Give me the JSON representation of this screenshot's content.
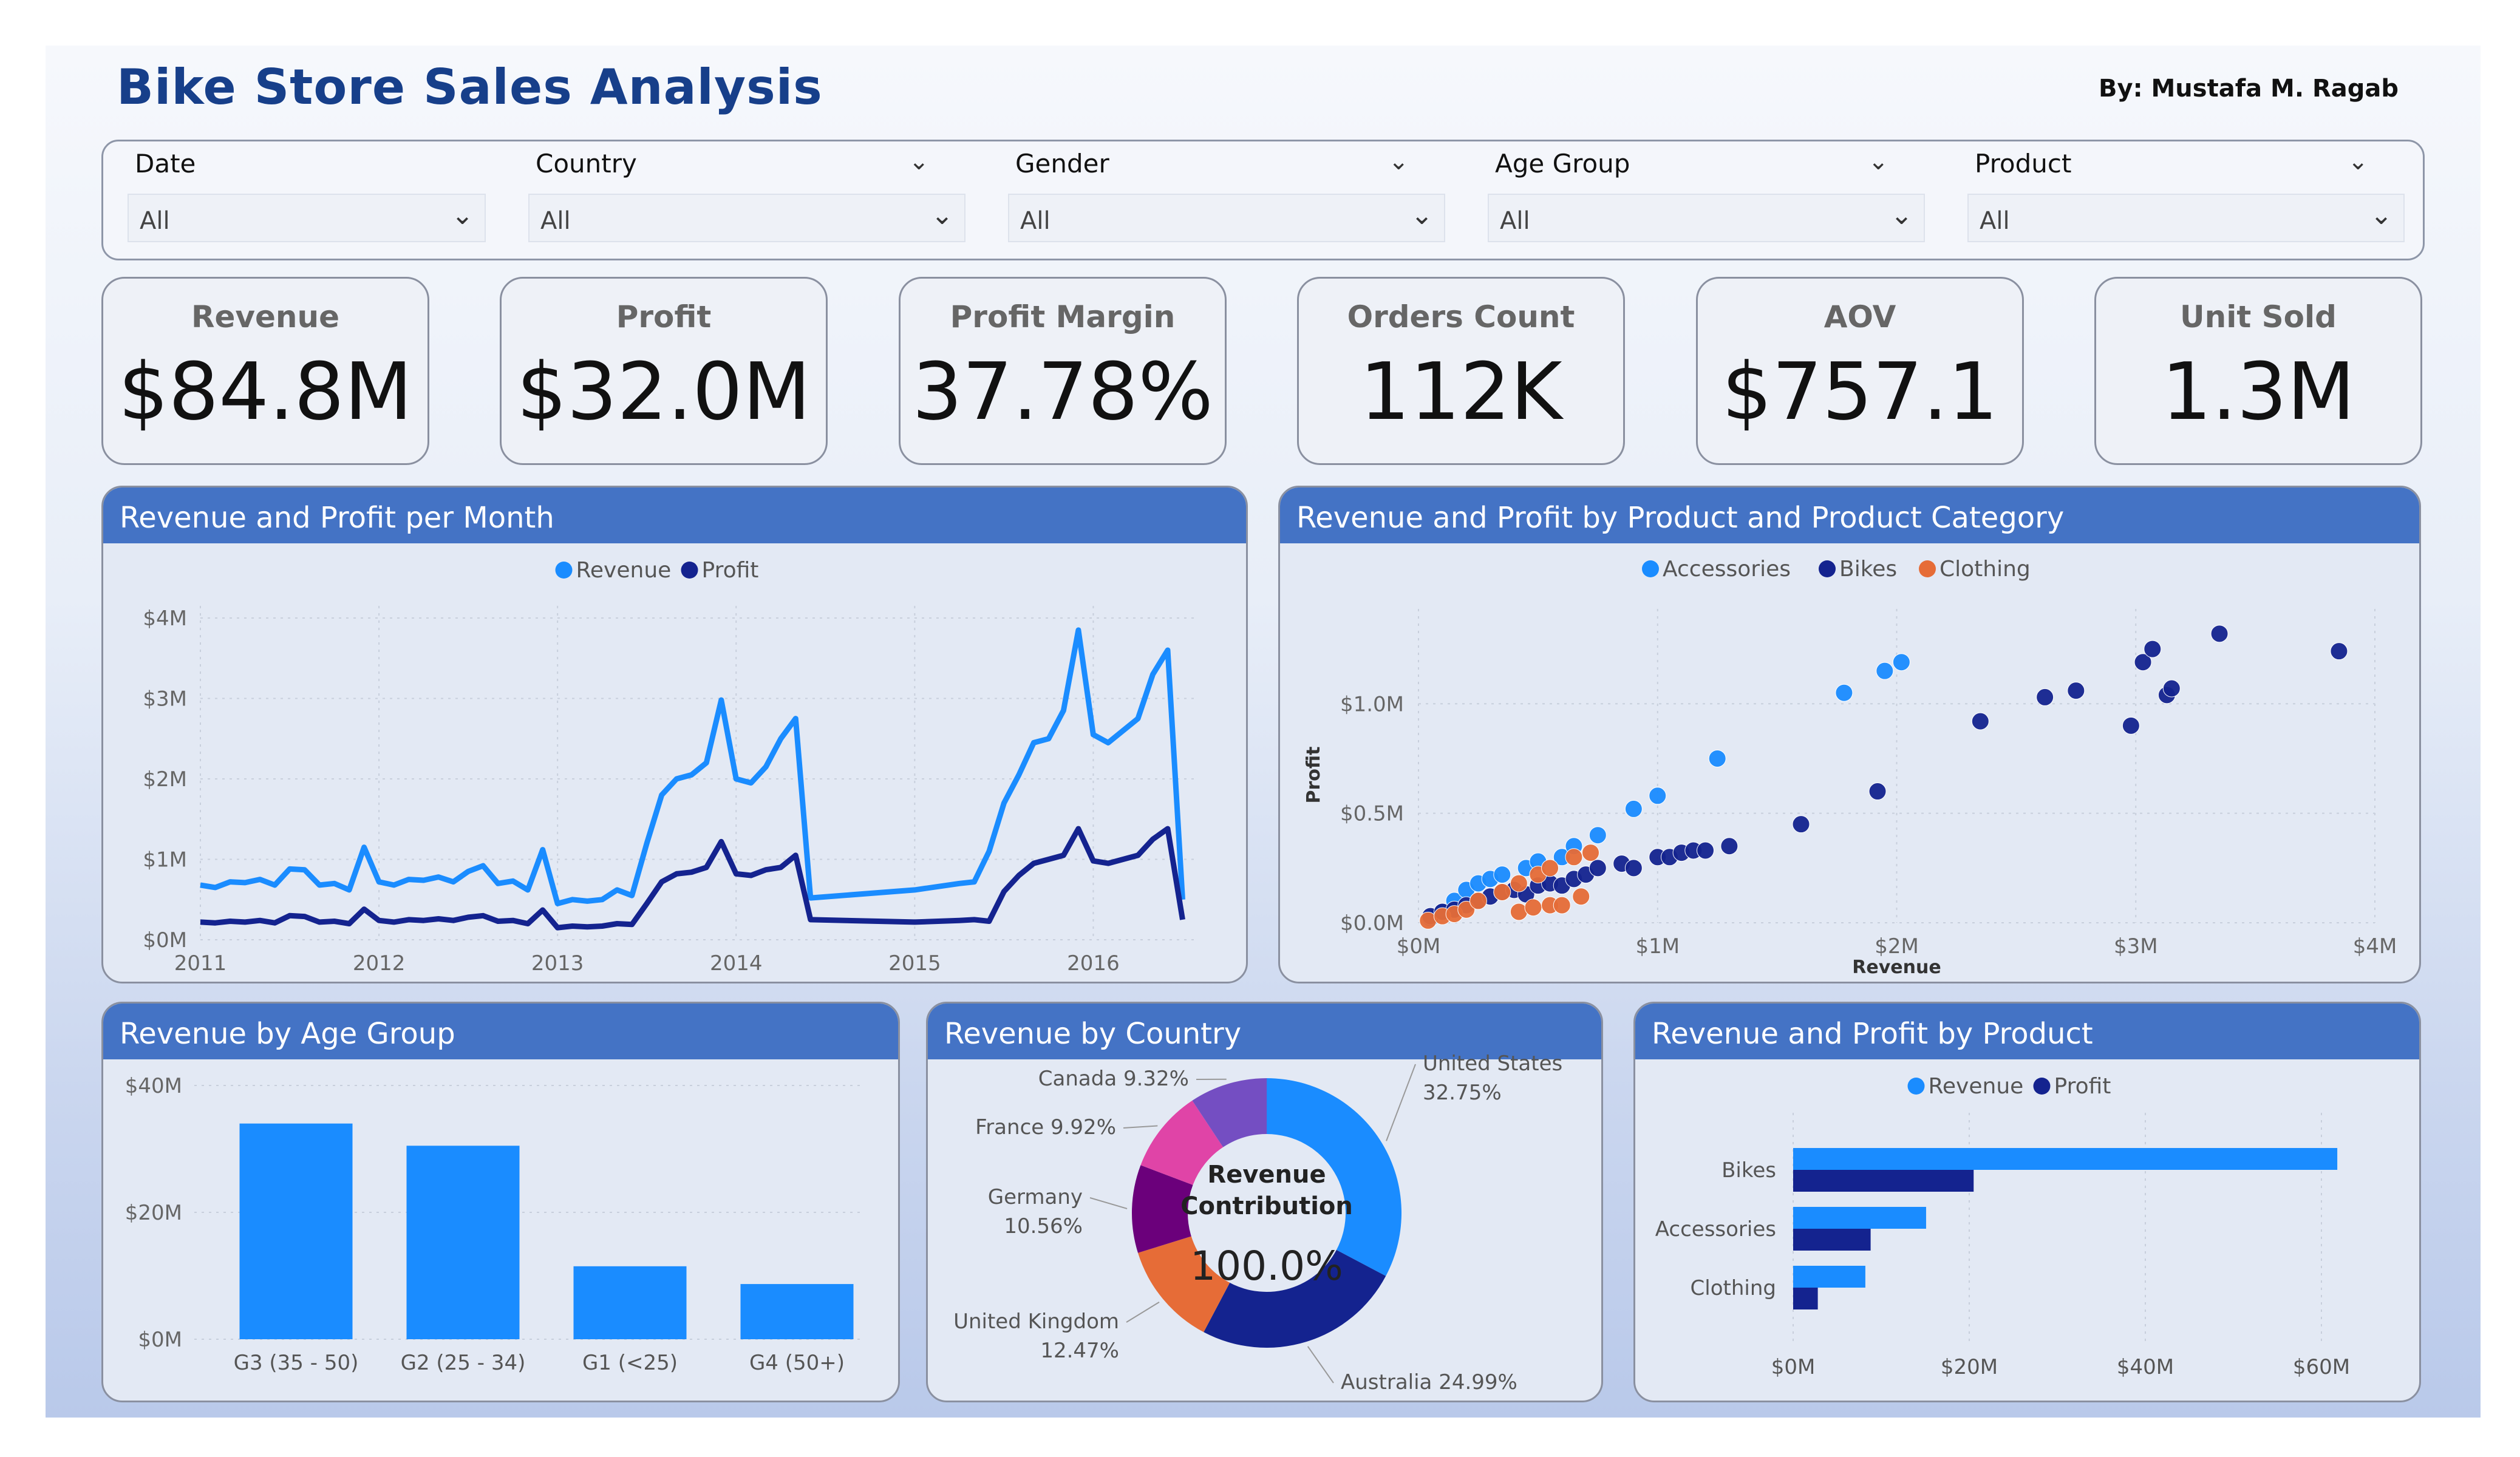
{
  "header": {
    "title": "Bike Store Sales Analysis",
    "author": "By: Mustafa M. Ragab"
  },
  "filters": [
    {
      "label": "Date",
      "value": "All"
    },
    {
      "label": "Country",
      "value": "All"
    },
    {
      "label": "Gender",
      "value": "All"
    },
    {
      "label": "Age Group",
      "value": "All"
    },
    {
      "label": "Product",
      "value": "All"
    }
  ],
  "kpis": [
    {
      "label": "Revenue",
      "value": "$84.8M"
    },
    {
      "label": "Profit",
      "value": "$32.0M"
    },
    {
      "label": "Profit Margin",
      "value": "37.78%"
    },
    {
      "label": "Orders Count",
      "value": "112K"
    },
    {
      "label": "AOV",
      "value": "$757.1"
    },
    {
      "label": "Unit Sold",
      "value": "1.3M"
    }
  ],
  "colors": {
    "revenue": "#1a8cff",
    "profit": "#14238f",
    "accessories": "#1a8cff",
    "bikes": "#14238f",
    "clothing": "#e66c37",
    "header": "#4473c5"
  },
  "chart_data": [
    {
      "id": "monthly",
      "type": "line",
      "title": "Revenue and Profit per Month",
      "legend": [
        "Revenue",
        "Profit"
      ],
      "y_ticks": [
        "$0M",
        "$1M",
        "$2M",
        "$3M",
        "$4M"
      ],
      "x_ticks": [
        "2011",
        "2012",
        "2013",
        "2014",
        "2015",
        "2016"
      ],
      "ylim": [
        0,
        4
      ],
      "x_unit": "months since Jan 2011",
      "series": [
        {
          "name": "Revenue",
          "points": [
            [
              0,
              0.68
            ],
            [
              1,
              0.65
            ],
            [
              2,
              0.72
            ],
            [
              3,
              0.71
            ],
            [
              4,
              0.75
            ],
            [
              5,
              0.68
            ],
            [
              6,
              0.88
            ],
            [
              7,
              0.87
            ],
            [
              8,
              0.68
            ],
            [
              9,
              0.7
            ],
            [
              10,
              0.62
            ],
            [
              11,
              1.15
            ],
            [
              12,
              0.72
            ],
            [
              13,
              0.68
            ],
            [
              14,
              0.75
            ],
            [
              15,
              0.74
            ],
            [
              16,
              0.78
            ],
            [
              17,
              0.72
            ],
            [
              18,
              0.85
            ],
            [
              19,
              0.92
            ],
            [
              20,
              0.7
            ],
            [
              21,
              0.73
            ],
            [
              22,
              0.62
            ],
            [
              23,
              1.12
            ],
            [
              24,
              0.45
            ],
            [
              25,
              0.5
            ],
            [
              26,
              0.48
            ],
            [
              27,
              0.5
            ],
            [
              28,
              0.62
            ],
            [
              29,
              0.55
            ],
            [
              30,
              1.2
            ],
            [
              31,
              1.8
            ],
            [
              32,
              2.0
            ],
            [
              33,
              2.05
            ],
            [
              34,
              2.2
            ],
            [
              35,
              2.98
            ],
            [
              36,
              2.0
            ],
            [
              37,
              1.95
            ],
            [
              38,
              2.15
            ],
            [
              39,
              2.5
            ],
            [
              40,
              2.75
            ],
            [
              41,
              0.52
            ],
            [
              48,
              0.62
            ],
            [
              51,
              0.7
            ],
            [
              52,
              0.72
            ],
            [
              53,
              1.1
            ],
            [
              54,
              1.7
            ],
            [
              55,
              2.05
            ],
            [
              56,
              2.45
            ],
            [
              57,
              2.5
            ],
            [
              58,
              2.85
            ],
            [
              59,
              3.85
            ],
            [
              60,
              2.55
            ],
            [
              61,
              2.45
            ],
            [
              62,
              2.6
            ],
            [
              63,
              2.75
            ],
            [
              64,
              3.3
            ],
            [
              65,
              3.6
            ],
            [
              66,
              0.5
            ]
          ]
        },
        {
          "name": "Profit",
          "points": [
            [
              0,
              0.22
            ],
            [
              1,
              0.21
            ],
            [
              2,
              0.23
            ],
            [
              3,
              0.22
            ],
            [
              4,
              0.24
            ],
            [
              5,
              0.21
            ],
            [
              6,
              0.3
            ],
            [
              7,
              0.29
            ],
            [
              8,
              0.22
            ],
            [
              9,
              0.23
            ],
            [
              10,
              0.2
            ],
            [
              11,
              0.38
            ],
            [
              12,
              0.24
            ],
            [
              13,
              0.22
            ],
            [
              14,
              0.25
            ],
            [
              15,
              0.24
            ],
            [
              16,
              0.26
            ],
            [
              17,
              0.24
            ],
            [
              18,
              0.28
            ],
            [
              19,
              0.3
            ],
            [
              20,
              0.23
            ],
            [
              21,
              0.24
            ],
            [
              22,
              0.2
            ],
            [
              23,
              0.37
            ],
            [
              24,
              0.15
            ],
            [
              25,
              0.17
            ],
            [
              26,
              0.16
            ],
            [
              27,
              0.17
            ],
            [
              28,
              0.2
            ],
            [
              29,
              0.19
            ],
            [
              30,
              0.45
            ],
            [
              31,
              0.72
            ],
            [
              32,
              0.82
            ],
            [
              33,
              0.84
            ],
            [
              34,
              0.9
            ],
            [
              35,
              1.22
            ],
            [
              36,
              0.82
            ],
            [
              37,
              0.8
            ],
            [
              38,
              0.87
            ],
            [
              39,
              0.9
            ],
            [
              40,
              1.05
            ],
            [
              41,
              0.25
            ],
            [
              48,
              0.22
            ],
            [
              51,
              0.24
            ],
            [
              52,
              0.25
            ],
            [
              53,
              0.23
            ],
            [
              54,
              0.6
            ],
            [
              55,
              0.8
            ],
            [
              56,
              0.95
            ],
            [
              57,
              1.0
            ],
            [
              58,
              1.05
            ],
            [
              59,
              1.38
            ],
            [
              60,
              0.98
            ],
            [
              61,
              0.95
            ],
            [
              62,
              1.0
            ],
            [
              63,
              1.05
            ],
            [
              64,
              1.25
            ],
            [
              65,
              1.38
            ],
            [
              66,
              0.25
            ]
          ]
        }
      ]
    },
    {
      "id": "scatter",
      "type": "scatter",
      "title": "Revenue and Profit by Product and Product Category",
      "legend": [
        "Accessories",
        "Bikes",
        "Clothing"
      ],
      "xlabel": "Revenue",
      "ylabel": "Profit",
      "x_ticks": [
        "$0M",
        "$1M",
        "$2M",
        "$3M",
        "$4M"
      ],
      "y_ticks": [
        "$0.0M",
        "$0.5M",
        "$1.0M"
      ],
      "xlim": [
        0,
        4
      ],
      "ylim": [
        0,
        1.35
      ],
      "series": [
        {
          "name": "Accessories",
          "points": [
            [
              0.05,
              0.02
            ],
            [
              0.1,
              0.05
            ],
            [
              0.15,
              0.1
            ],
            [
              0.2,
              0.15
            ],
            [
              0.25,
              0.18
            ],
            [
              0.3,
              0.2
            ],
            [
              0.35,
              0.22
            ],
            [
              0.45,
              0.25
            ],
            [
              0.5,
              0.28
            ],
            [
              0.6,
              0.3
            ],
            [
              0.65,
              0.35
            ],
            [
              0.75,
              0.4
            ],
            [
              0.9,
              0.52
            ],
            [
              1.0,
              0.58
            ],
            [
              1.25,
              0.75
            ],
            [
              1.78,
              1.05
            ],
            [
              1.95,
              1.15
            ],
            [
              2.02,
              1.19
            ]
          ]
        },
        {
          "name": "Bikes",
          "points": [
            [
              0.05,
              0.03
            ],
            [
              0.1,
              0.05
            ],
            [
              0.15,
              0.06
            ],
            [
              0.2,
              0.08
            ],
            [
              0.25,
              0.1
            ],
            [
              0.3,
              0.12
            ],
            [
              0.35,
              0.14
            ],
            [
              0.4,
              0.15
            ],
            [
              0.45,
              0.13
            ],
            [
              0.5,
              0.17
            ],
            [
              0.55,
              0.18
            ],
            [
              0.6,
              0.17
            ],
            [
              0.65,
              0.2
            ],
            [
              0.7,
              0.22
            ],
            [
              0.75,
              0.25
            ],
            [
              0.85,
              0.27
            ],
            [
              0.9,
              0.25
            ],
            [
              1.0,
              0.3
            ],
            [
              1.05,
              0.3
            ],
            [
              1.1,
              0.32
            ],
            [
              1.15,
              0.33
            ],
            [
              1.2,
              0.33
            ],
            [
              1.3,
              0.35
            ],
            [
              1.6,
              0.45
            ],
            [
              1.92,
              0.6
            ],
            [
              2.35,
              0.92
            ],
            [
              2.62,
              1.03
            ],
            [
              2.75,
              1.06
            ],
            [
              2.98,
              0.9
            ],
            [
              3.03,
              1.19
            ],
            [
              3.07,
              1.25
            ],
            [
              3.13,
              1.04
            ],
            [
              3.15,
              1.07
            ],
            [
              3.35,
              1.32
            ],
            [
              3.85,
              1.24
            ]
          ]
        },
        {
          "name": "Clothing",
          "points": [
            [
              0.04,
              0.01
            ],
            [
              0.1,
              0.03
            ],
            [
              0.15,
              0.04
            ],
            [
              0.2,
              0.06
            ],
            [
              0.25,
              0.1
            ],
            [
              0.35,
              0.14
            ],
            [
              0.42,
              0.18
            ],
            [
              0.5,
              0.22
            ],
            [
              0.55,
              0.25
            ],
            [
              0.65,
              0.3
            ],
            [
              0.72,
              0.32
            ],
            [
              0.42,
              0.05
            ],
            [
              0.48,
              0.07
            ],
            [
              0.55,
              0.08
            ],
            [
              0.6,
              0.08
            ],
            [
              0.68,
              0.12
            ]
          ]
        }
      ]
    },
    {
      "id": "age",
      "type": "bar",
      "title": "Revenue by Age Group",
      "categories": [
        "G3 (35 - 50)",
        "G2 (25 - 34)",
        "G1 (<25)",
        "G4 (50+)"
      ],
      "values": [
        34,
        30.5,
        11.5,
        8.7
      ],
      "y_ticks": [
        "$0M",
        "$20M",
        "$40M"
      ],
      "ylim": [
        0,
        40
      ]
    },
    {
      "id": "country",
      "type": "pie",
      "title": "Revenue by Country",
      "center_label": "Revenue\nContribution",
      "center_value": "100.0%",
      "slices": [
        {
          "name": "United States",
          "value": 32.75,
          "label": "United States\n32.75%",
          "color": "#1a8cff"
        },
        {
          "name": "Australia",
          "value": 24.99,
          "label": "Australia 24.99%",
          "color": "#14238f"
        },
        {
          "name": "United Kingdom",
          "value": 12.47,
          "label": "United Kingdom\n12.47%",
          "color": "#e66c37"
        },
        {
          "name": "Germany",
          "value": 10.56,
          "label": "Germany\n10.56%",
          "color": "#6b007b"
        },
        {
          "name": "France",
          "value": 9.92,
          "label": "France 9.92%",
          "color": "#e044a7"
        },
        {
          "name": "Canada",
          "value": 9.32,
          "label": "Canada 9.32%",
          "color": "#744ec2"
        }
      ]
    },
    {
      "id": "product",
      "type": "bar",
      "orientation": "horizontal",
      "title": "Revenue and Profit by Product",
      "legend": [
        "Revenue",
        "Profit"
      ],
      "categories": [
        "Bikes",
        "Accessories",
        "Clothing"
      ],
      "series": [
        {
          "name": "Revenue",
          "values": [
            61.8,
            15.1,
            8.2
          ]
        },
        {
          "name": "Profit",
          "values": [
            20.5,
            8.8,
            2.8
          ]
        }
      ],
      "x_ticks": [
        "$0M",
        "$20M",
        "$40M",
        "$60M"
      ],
      "xlim": [
        0,
        60
      ]
    }
  ]
}
